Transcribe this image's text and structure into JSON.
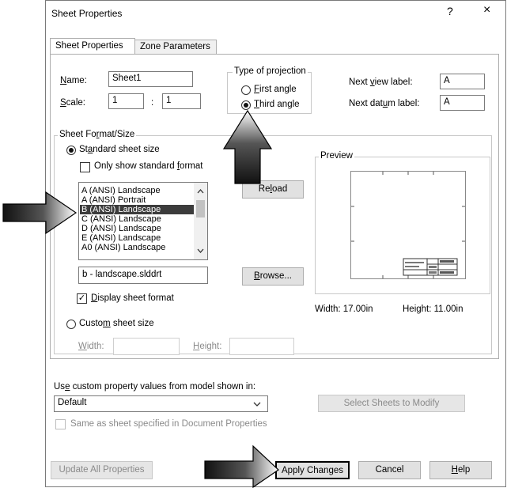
{
  "dialog": {
    "title": "Sheet Properties",
    "help_glyph": "?",
    "close_glyph": "×"
  },
  "tabs": [
    {
      "label": "Sheet Properties",
      "active": true
    },
    {
      "label": "Zone Parameters",
      "active": false
    }
  ],
  "name": {
    "label": "Name:",
    "value": "Sheet1"
  },
  "scale": {
    "label": "Scale:",
    "numerator": "1",
    "separator": ":",
    "denominator": "1"
  },
  "projection": {
    "legend": "Type of projection",
    "first_angle": "First angle",
    "third_angle": "Third angle",
    "selected": "third_angle"
  },
  "next_view_label": {
    "label": "Next view label:",
    "value": "A"
  },
  "next_datum_label": {
    "label": "Next datum label:",
    "value": "A"
  },
  "sheet_format": {
    "legend": "Sheet Format/Size",
    "standard_size": "Standard sheet size",
    "only_standard": "Only show standard format",
    "only_standard_checked": false,
    "sizes": [
      "A (ANSI) Landscape",
      "A (ANSI) Portrait",
      "B (ANSI) Landscape",
      "C (ANSI) Landscape",
      "D (ANSI) Landscape",
      "E (ANSI) Landscape",
      "A0 (ANSI) Landscape"
    ],
    "selected_size": "B (ANSI) Landscape",
    "reload": "Reload",
    "format_file": "b - landscape.slddrt",
    "browse": "Browse...",
    "display_format": "Display sheet format",
    "display_format_checked": true,
    "custom_size": "Custom sheet size",
    "width_label": "Width:",
    "height_label": "Height:"
  },
  "preview": {
    "legend": "Preview",
    "width_text": "Width: 17.00in",
    "height_text": "Height: 11.00in"
  },
  "custom_property": {
    "label": "Use custom property values from model shown in:",
    "dropdown_value": "Default",
    "select_sheets": "Select Sheets to Modify",
    "same_as_sheet": "Same as sheet specified in Document Properties"
  },
  "footer": {
    "update_all": "Update All Properties",
    "apply": "Apply Changes",
    "cancel": "Cancel",
    "help": "Help"
  },
  "colors": {
    "arrow_dark": "#111111",
    "selection": "#3c3c3c",
    "disabled_text": "#8a8a8a"
  }
}
